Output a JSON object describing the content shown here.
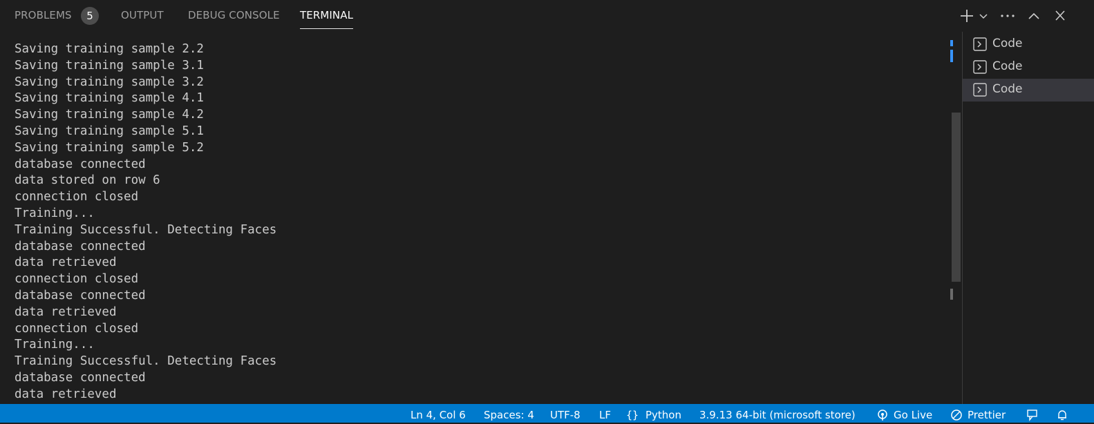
{
  "tabs": {
    "problems": "PROBLEMS",
    "problems_count": "5",
    "output": "OUTPUT",
    "debug_console": "DEBUG CONSOLE",
    "terminal": "TERMINAL"
  },
  "terminal_lines": [
    "Saving training sample 2.2",
    "Saving training sample 3.1",
    "Saving training sample 3.2",
    "Saving training sample 4.1",
    "Saving training sample 4.2",
    "Saving training sample 5.1",
    "Saving training sample 5.2",
    "database connected",
    "data stored on row 6",
    "connection closed",
    "Training...",
    "Training Successful. Detecting Faces",
    "database connected",
    "data retrieved",
    "connection closed",
    "database connected",
    "data retrieved",
    "connection closed",
    "Training...",
    "Training Successful. Detecting Faces",
    "database connected",
    "data retrieved"
  ],
  "terminal_list": [
    {
      "label": "Code",
      "selected": false
    },
    {
      "label": "Code",
      "selected": false
    },
    {
      "label": "Code",
      "selected": true
    }
  ],
  "statusbar": {
    "position": "Ln 4, Col 6",
    "spaces": "Spaces: 4",
    "encoding": "UTF-8",
    "eol": "LF",
    "language": "Python",
    "interpreter": "3.9.13 64-bit (microsoft store)",
    "go_live": "Go Live",
    "prettier": "Prettier"
  },
  "icons": {
    "new_terminal": "plus-icon",
    "dropdown": "chevron-down-icon",
    "more": "ellipsis-icon",
    "maximize": "chevron-up-icon",
    "close": "close-icon",
    "terminal": "terminal-icon",
    "braces": "braces-icon",
    "broadcast": "broadcast-icon",
    "prettier": "prohibited-icon",
    "feedback": "feedback-icon",
    "bell": "bell-icon"
  },
  "colors": {
    "background": "#1e1e1e",
    "statusbar": "#007acc",
    "text": "#cccccc",
    "scroll_accent": "#3794ff"
  }
}
